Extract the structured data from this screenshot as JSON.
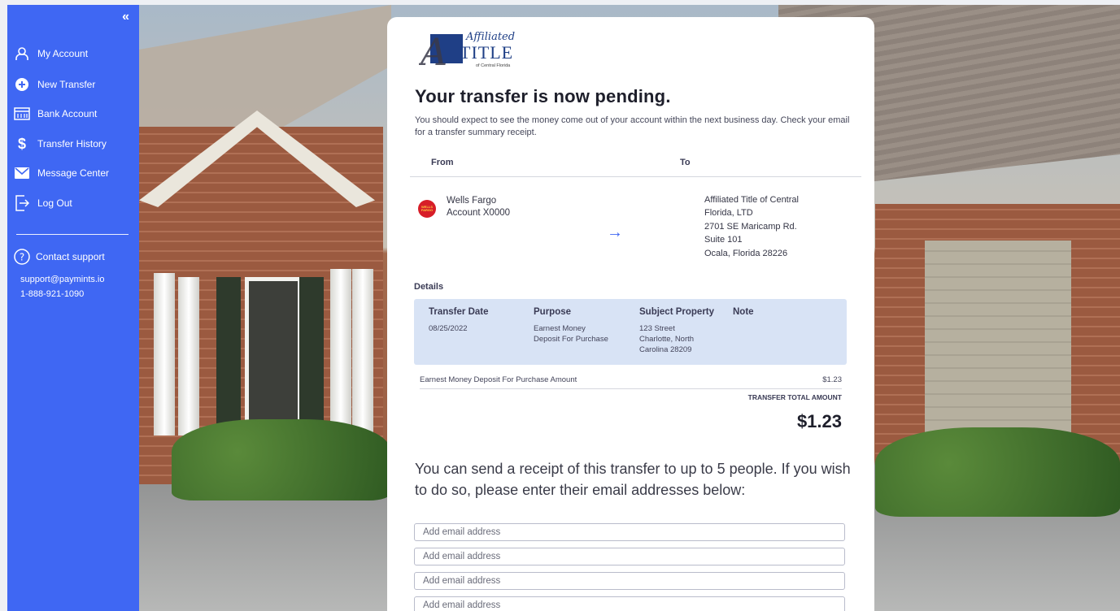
{
  "sidebar": {
    "collapse_icon": "double-chevron-left-icon",
    "items": [
      {
        "label": "My Account",
        "icon": "user-icon"
      },
      {
        "label": "New Transfer",
        "icon": "plus-circle-icon"
      },
      {
        "label": "Bank Account",
        "icon": "bank-icon"
      },
      {
        "label": "Transfer History",
        "icon": "dollar-icon"
      },
      {
        "label": "Message Center",
        "icon": "mail-icon"
      },
      {
        "label": "Log Out",
        "icon": "logout-icon"
      }
    ],
    "support": {
      "label": "Contact support",
      "icon": "question-circle-icon",
      "email": "support@paymints.io",
      "phone": "1-888-921-1090"
    }
  },
  "logo": {
    "script_text": "Affiliated",
    "main_text": "TITLE",
    "sub_text": "of Central Florida"
  },
  "page": {
    "title": "Your transfer is now pending.",
    "intro": "You should expect to see the money come out of your account within the next business day. Check your email for a transfer summary receipt.",
    "from_label": "From",
    "to_label": "To",
    "from": {
      "bank": "Wells Fargo",
      "account": "Account X0000",
      "logo_text": "WELLS FARGO"
    },
    "to": {
      "lines": [
        "Affiliated Title of Central",
        "Florida, LTD",
        "2701 SE Maricamp Rd.",
        "Suite 101",
        "Ocala, Florida 28226"
      ]
    },
    "details_label": "Details",
    "details": {
      "headers": [
        "Transfer Date",
        "Purpose",
        "Subject Property",
        "Note"
      ],
      "date": "08/25/2022",
      "purpose": [
        "Earnest Money",
        "Deposit For Purchase"
      ],
      "property": [
        "123 Street",
        "Charlotte, North",
        "Carolina 28209"
      ],
      "note": ""
    },
    "amount_label": "Earnest Money Deposit For Purchase Amount",
    "amount_value": "$1.23",
    "total_label": "TRANSFER TOTAL AMOUNT",
    "total_value": "$1.23",
    "receipt_text": "You can send a receipt of this transfer to up to 5 people. If you wish to do so, please enter their email addresses below:",
    "email_placeholder": "Add email address"
  },
  "colors": {
    "sidebar": "#3f67f3",
    "accent": "#3f67f3",
    "details_bg": "#d8e3f5"
  }
}
